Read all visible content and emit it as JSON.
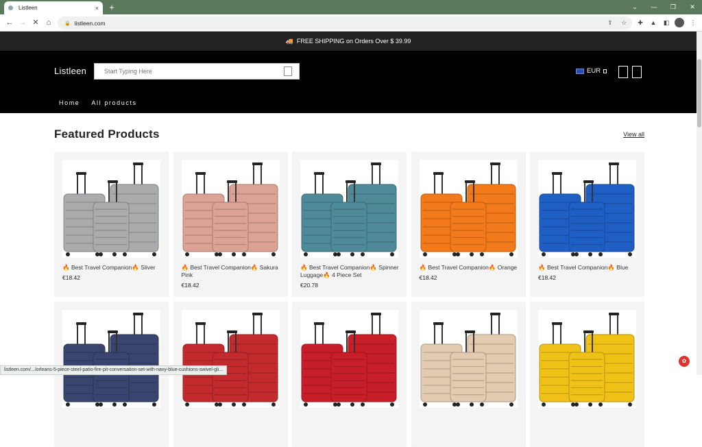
{
  "browser": {
    "tab_title": "Listleen",
    "tab_close": "×",
    "new_tab": "+",
    "url": "listleen.com",
    "status_url": "listleen.com/.../orleans-5-piece-steel-patio-fire-pit-conversation-set-with-navy-blue-cushions-swivel-gli..."
  },
  "announcement": {
    "text": "FREE SHIPPING on Orders Over $ 39.99"
  },
  "header": {
    "logo": "Listleen",
    "search_placeholder": "Start Typing Here",
    "currency": "EUR",
    "nav": [
      "Home",
      "All products"
    ]
  },
  "section": {
    "title": "Featured Products",
    "view_all": "View all"
  },
  "colors": {
    "brand_bg": "#000000",
    "browser_frame": "#5b7a5d",
    "fire": "#e86a10"
  },
  "products": [
    {
      "name_prefix": "Best Travel Companion",
      "variant": "Sliver",
      "price": "€18.42",
      "color": "#a9abad"
    },
    {
      "name_prefix": "Best Travel Companion",
      "variant": "Sakura Pink",
      "price": "€18.42",
      "color": "#dca295"
    },
    {
      "name_prefix": "Best Travel Companion",
      "variant": "Spinner Luggage",
      "extra": "4 Piece Set",
      "price": "€20.78",
      "color": "#4f8a98"
    },
    {
      "name_prefix": "Best Travel Companion",
      "variant": "Orange",
      "price": "€18.42",
      "color": "#f27a1a"
    },
    {
      "name_prefix": "Best Travel Companion",
      "variant": "Blue",
      "price": "€18.42",
      "color": "#1f5fc4"
    },
    {
      "color": "#39456f"
    },
    {
      "color": "#c22a2e"
    },
    {
      "color": "#c81e2a"
    },
    {
      "color": "#e2cbb0"
    },
    {
      "color": "#f0c218"
    }
  ]
}
